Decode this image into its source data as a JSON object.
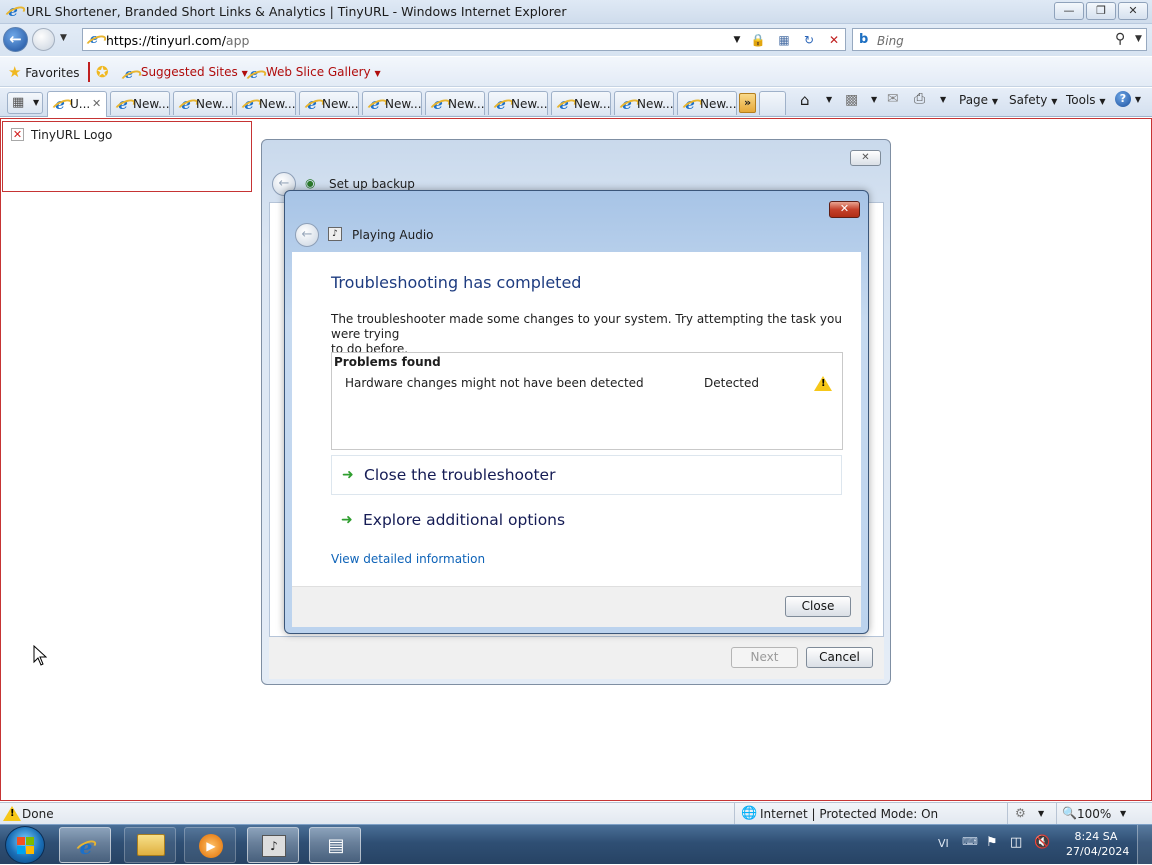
{
  "window": {
    "title": "URL Shortener, Branded Short Links & Analytics | TinyURL - Windows Internet Explorer"
  },
  "address": {
    "url_host": "https://tinyurl.com/",
    "url_path": "app"
  },
  "search": {
    "placeholder": "Bing"
  },
  "favorites": {
    "favorites_label": "Favorites",
    "suggested_sites": "Suggested Sites",
    "web_slice_gallery": "Web Slice Gallery"
  },
  "tabs": [
    {
      "label": "U...",
      "active": true
    },
    {
      "label": "New..."
    },
    {
      "label": "New..."
    },
    {
      "label": "New..."
    },
    {
      "label": "New..."
    },
    {
      "label": "New..."
    },
    {
      "label": "New..."
    },
    {
      "label": "New..."
    },
    {
      "label": "New..."
    },
    {
      "label": "New..."
    },
    {
      "label": "New..."
    }
  ],
  "commandbar": {
    "page": "Page",
    "safety": "Safety",
    "tools": "Tools"
  },
  "page": {
    "logo_alt": "TinyURL Logo"
  },
  "backup_dialog": {
    "title": "Set up backup",
    "next": "Next",
    "cancel": "Cancel"
  },
  "troubleshooter": {
    "title": "Playing Audio",
    "heading": "Troubleshooting has completed",
    "description_line1": "The troubleshooter made some changes to your system. Try attempting the task you were trying",
    "description_line2": "to do before.",
    "problems_header": "Problems found",
    "problem_name": "Hardware changes might not have been detected",
    "problem_status": "Detected",
    "option_close": "Close the troubleshooter",
    "option_explore": "Explore additional options",
    "details_link": "View detailed information",
    "close_button": "Close"
  },
  "statusbar": {
    "status": "Done",
    "zone": "Internet | Protected Mode: On",
    "zoom": "100%"
  },
  "taskbar": {
    "language": "VI",
    "time": "8:24 SA",
    "date": "27/04/2024"
  }
}
